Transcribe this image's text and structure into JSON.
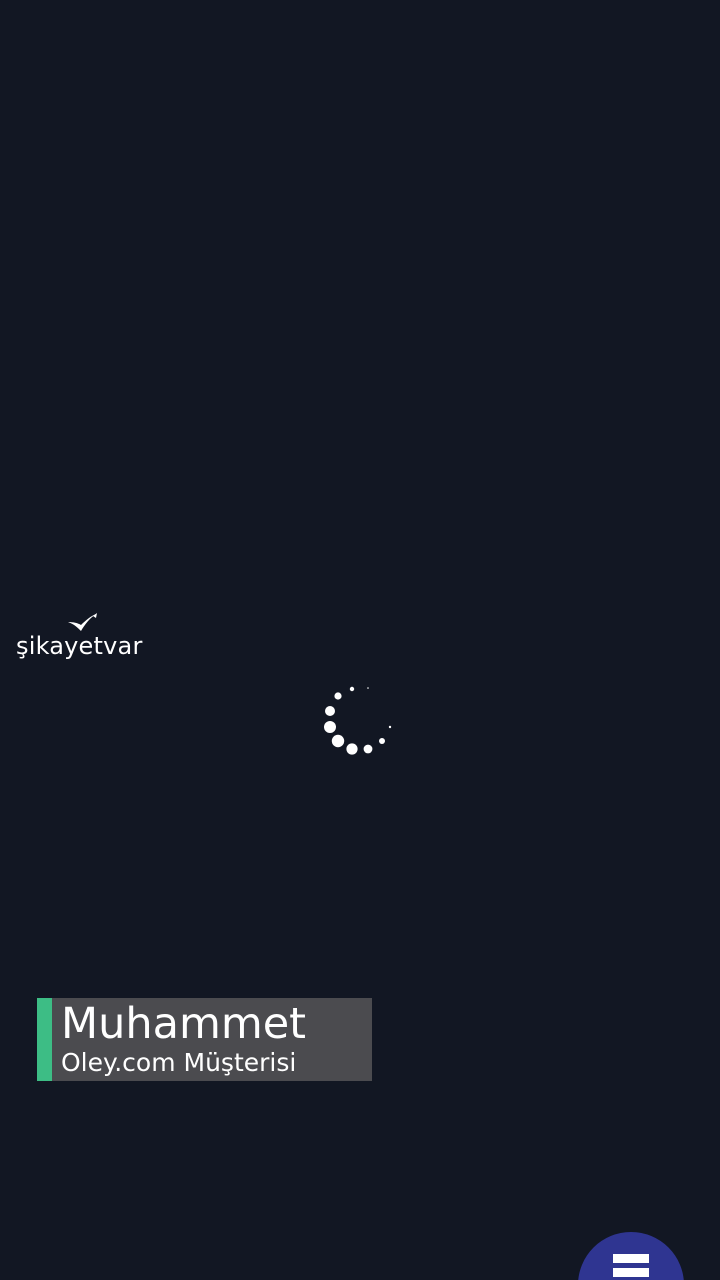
{
  "brand": {
    "logo_text": "şikayetvar",
    "logo_icon": "bird-check-icon"
  },
  "loader": {
    "icon": "loading-spinner-icon",
    "color": "#ffffff"
  },
  "video_caption": {
    "name": "Muhammet",
    "subtitle": "Oley.com Müşterisi",
    "accent_color": "#3dbd85"
  },
  "fab": {
    "icon": "menu-icon",
    "color": "#2f3591"
  },
  "colors": {
    "background": "#121723"
  }
}
